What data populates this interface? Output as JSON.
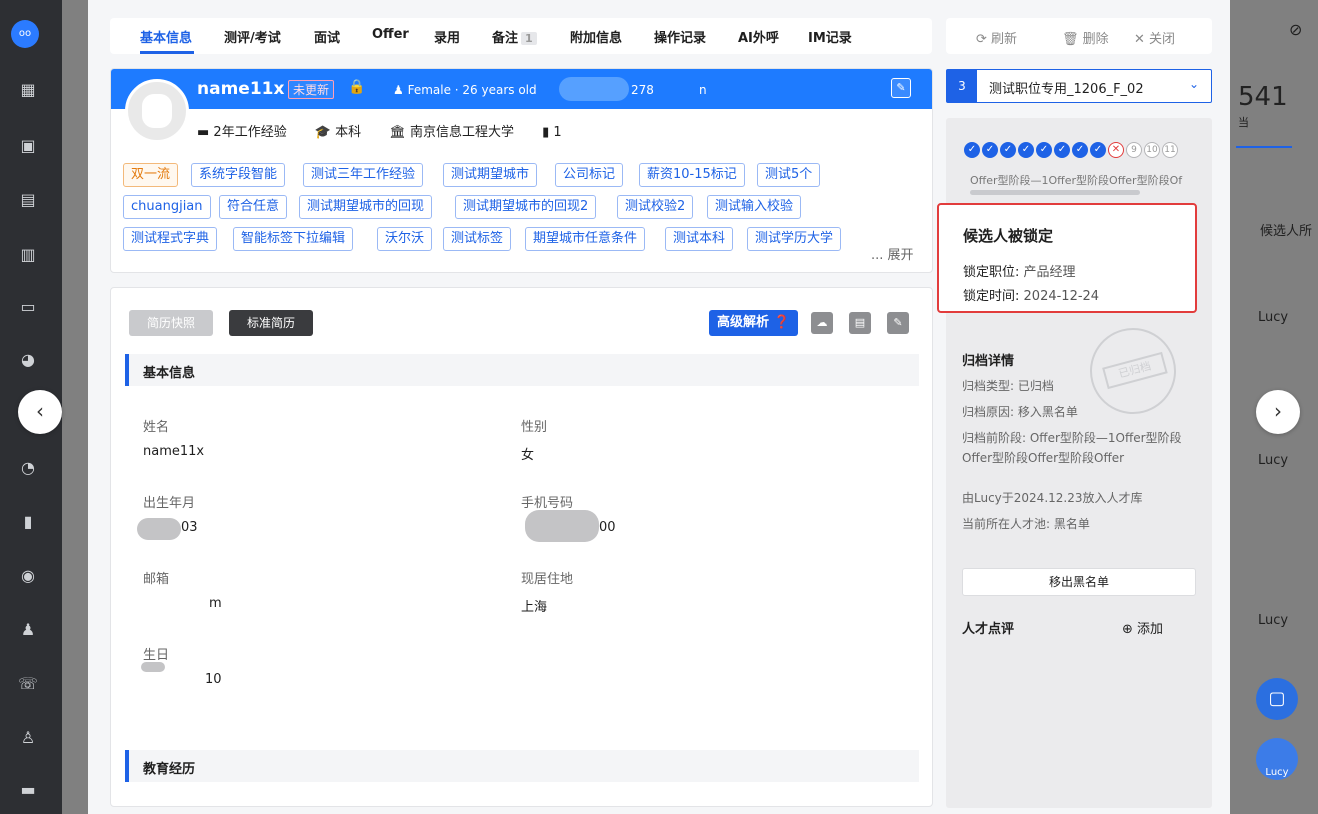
{
  "sidebar": {
    "logo": "oo"
  },
  "background": {
    "num": "541",
    "cand_col": "候选人所",
    "lucy": "Lucy",
    "peek_side": "当",
    "float_label": "Lucy"
  },
  "tabs": [
    {
      "label": "基本信息"
    },
    {
      "label": "测评/考试"
    },
    {
      "label": "面试"
    },
    {
      "label": "Offer"
    },
    {
      "label": "录用"
    },
    {
      "label": "备注"
    },
    {
      "label": "附加信息"
    },
    {
      "label": "操作记录"
    },
    {
      "label": "AI外呼"
    },
    {
      "label": "IM记录"
    }
  ],
  "notes_count": "1",
  "actions": {
    "refresh": "⟳ 刷新",
    "delete": "🗑 删除",
    "close": "✕ 关闭"
  },
  "header": {
    "name": "name11x",
    "status_tag": "未更新",
    "gender_age": "♟ Female · 26 years old",
    "phone_tail": "278",
    "extra": "n",
    "experience": "2年工作经验",
    "degree": "本科",
    "school": "南京信息工程大学",
    "resume_count": "1",
    "expand": "... 展开",
    "tags": [
      "双一流",
      "系统字段智能",
      "测试三年工作经验",
      "测试期望城市",
      "公司标记",
      "薪资10-15标记",
      "测试5个",
      "chuangjian",
      "符合任意",
      "测试期望城市的回现",
      "测试期望城市的回现2",
      "测试校验2",
      "测试输入校验",
      "测试程式字典",
      "智能标签下拉编辑",
      "沃尔沃",
      "测试标签",
      "期望城市任意条件",
      "测试本科",
      "测试学历大学"
    ]
  },
  "resume": {
    "snapshot_btn": "简历快照",
    "standard_btn": "标准简历",
    "advanced": "高级解析 ❓",
    "basic_title": "基本信息",
    "edu_title": "教育经历",
    "fields": {
      "name_label": "姓名",
      "name_value": "name11x",
      "gender_label": "性别",
      "gender_value": "女",
      "birth_label": "出生年月",
      "birth_value": "03",
      "phone_label": "手机号码",
      "phone_value": "00",
      "email_label": "邮箱",
      "email_value": "m",
      "residence_label": "现居住地",
      "residence_value": "上海",
      "birthday_label": "生日",
      "birthday_value": "10"
    }
  },
  "position_select": {
    "index": "3",
    "value": "测试职位专用_1206_F_02"
  },
  "progress": {
    "steps": [
      "✓",
      "✓",
      "✓",
      "✓",
      "✓",
      "✓",
      "✓",
      "✓",
      "✕",
      "9",
      "10",
      "11"
    ],
    "label": "Offer型阶段—1Offer型阶段Offer型阶段Of"
  },
  "lock": {
    "title": "候选人被锁定",
    "pos_label": "锁定职位:",
    "pos_value": "产品经理",
    "time_label": "锁定时间:",
    "time_value": "2024-12-24"
  },
  "archive": {
    "title": "归档详情",
    "stamp": "已归档",
    "type": "归档类型: 已归档",
    "reason": "归档原因: 移入黑名单",
    "prev_stage": "归档前阶段: Offer型阶段—1Offer型阶段Offer型阶段Offer型阶段Offer",
    "by": "由Lucy于2024.12.23放入人才库",
    "pool": "当前所在人才池: 黑名单",
    "remove_btn": "移出黑名单"
  },
  "comment": {
    "title": "人才点评",
    "add": "⊕ 添加"
  }
}
